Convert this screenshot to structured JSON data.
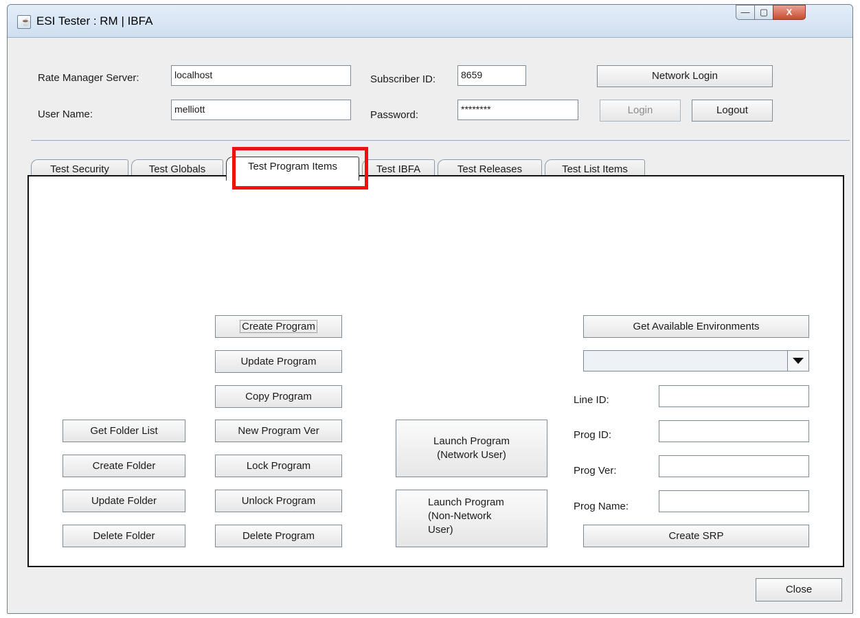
{
  "window": {
    "title": "ESI Tester :  RM | IBFA",
    "controls": {
      "minimize": "—",
      "maximize": "▢",
      "close": "X"
    }
  },
  "login": {
    "server_label": "Rate Manager Server:",
    "server_value": "localhost",
    "user_label": "User Name:",
    "user_value": "melliott",
    "subscriber_label": "Subscriber ID:",
    "subscriber_value": "8659",
    "password_label": "Password:",
    "password_value": "********",
    "network_login": "Network Login",
    "login": "Login",
    "logout": "Logout"
  },
  "tabs": [
    "Test Security",
    "Test Globals",
    "Test Program Items",
    "Test IBFA",
    "Test Releases",
    "Test List Items"
  ],
  "active_tab": "Test Program Items",
  "folder_buttons": [
    "Get Folder List",
    "Create Folder",
    "Update Folder",
    "Delete Folder"
  ],
  "program_buttons": [
    "Create Program",
    "Update Program",
    "Copy Program",
    "New Program Ver",
    "Lock Program",
    "Unlock Program",
    "Delete Program"
  ],
  "launch": {
    "network": [
      "Launch Program",
      "(Network User)"
    ],
    "non_network": [
      "Launch Program",
      "(Non-Network",
      "User)"
    ]
  },
  "environments": {
    "get_button": "Get Available Environments",
    "selected": ""
  },
  "fields": {
    "line_id": "Line ID:",
    "prog_id": "Prog ID:",
    "prog_ver": "Prog Ver:",
    "prog_name": "Prog Name:"
  },
  "create_srp": "Create SRP",
  "close": "Close",
  "colors": {
    "highlight": "#ee1111"
  }
}
